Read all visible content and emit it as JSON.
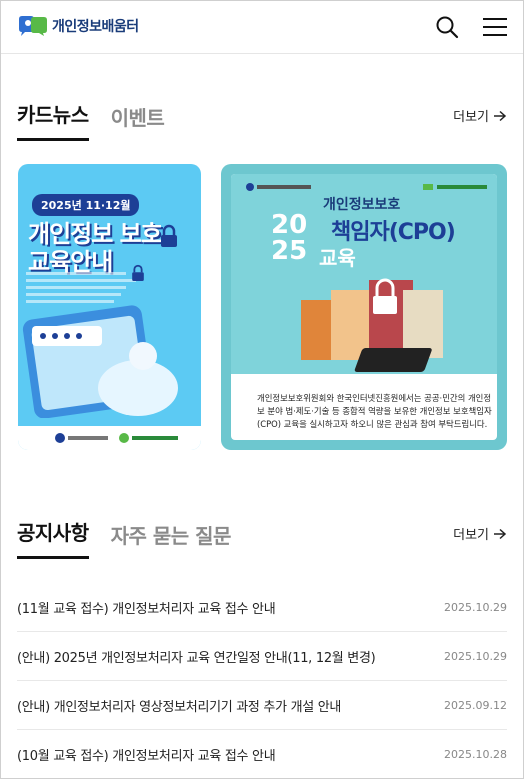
{
  "header": {
    "logo_text": "개인정보배움터"
  },
  "card_tabs": [
    {
      "label": "카드뉴스"
    },
    {
      "label": "이벤트"
    }
  ],
  "more_label": "더보기",
  "cards": [
    {
      "badge": "2025년 11·12월",
      "title_line1": "개인정보 보호",
      "title_line2": "교육안내"
    },
    {
      "subtitle": "개인정보보호",
      "title": "책임자(CPO)",
      "year_top": "20",
      "year_bottom": "25",
      "edu": "교육",
      "description": "개인정보보호위원회와 한국인터넷진흥원에서는 공공·민간의 개인정보 분야 법·제도·기술 등 종합적 역량을 보유한 개인정보 보호책임자(CPO) 교육을 실시하고자 하오니 많은 관심과 참여 부탁드립니다."
    }
  ],
  "notice_tabs": [
    {
      "label": "공지사항"
    },
    {
      "label": "자주 묻는 질문"
    }
  ],
  "notices": [
    {
      "title": "(11월 교육 접수) 개인정보처리자 교육 접수 안내",
      "date": "2025.10.29"
    },
    {
      "title": "(안내) 2025년 개인정보처리자 교육 연간일정 안내(11, 12월 변경)",
      "date": "2025.10.29"
    },
    {
      "title": "(안내) 개인정보처리자 영상정보처리기기 과정 추가 개설 안내",
      "date": "2025.09.12"
    },
    {
      "title": "(10월 교육 접수) 개인정보처리자 교육 접수 안내",
      "date": "2025.10.28"
    }
  ]
}
